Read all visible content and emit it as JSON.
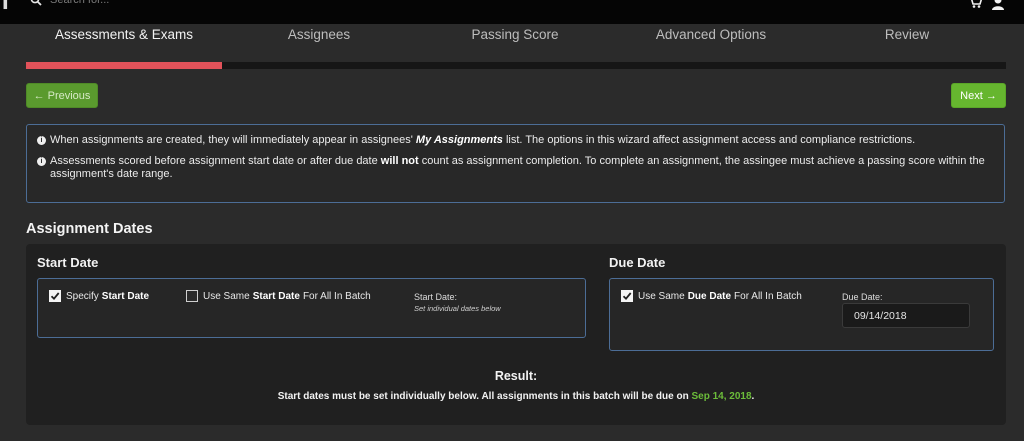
{
  "topbar": {
    "search_placeholder": "Search for..."
  },
  "steps": [
    {
      "label": "Assessments & Exams",
      "active": true
    },
    {
      "label": "Assignees",
      "active": false
    },
    {
      "label": "Passing Score",
      "active": false
    },
    {
      "label": "Advanced Options",
      "active": false
    },
    {
      "label": "Review",
      "active": false
    }
  ],
  "progress": {
    "fraction": 0.2,
    "color": "#e2525a"
  },
  "nav": {
    "previous_label": "← Previous",
    "next_label": "Next →"
  },
  "info": {
    "line1_before": "When assignments are created, they will immediately appear in assignees'",
    "line1_emph": "My Assignments",
    "line1_after": "list. The options in this wizard affect assignment access and compliance restrictions.",
    "line2_before": "Assessments scored before assignment start date or after due date",
    "line2_emph": "will not",
    "line2_after": "count as assignment completion. To complete an assignment, the assingee must achieve a passing score within the assignment's date range."
  },
  "assignment_dates": {
    "title": "Assignment Dates",
    "start_date": {
      "title": "Start Date",
      "specify": {
        "prefix": "Specify",
        "bold": "Start Date",
        "suffix": "",
        "checked": true
      },
      "same_for_all": {
        "prefix": "Use Same",
        "bold": "Start Date",
        "suffix": "For All In Batch",
        "checked": false
      },
      "field_label": "Start Date:",
      "field_note": "Set individual dates below"
    },
    "due_date": {
      "title": "Due Date",
      "same_for_all": {
        "prefix": "Use Same",
        "bold": "Due Date",
        "suffix": "For All In Batch",
        "checked": true
      },
      "field_label": "Due Date:",
      "value": "09/14/2018"
    },
    "result": {
      "title": "Result:",
      "text": "Start dates must be set individually below. All assignments in this batch will be due on",
      "date": "Sep 14, 2018",
      "end": "."
    }
  },
  "colors": {
    "accent_red": "#e2525a",
    "accent_green": "#66b62f",
    "border_blue": "#4c6d96"
  }
}
